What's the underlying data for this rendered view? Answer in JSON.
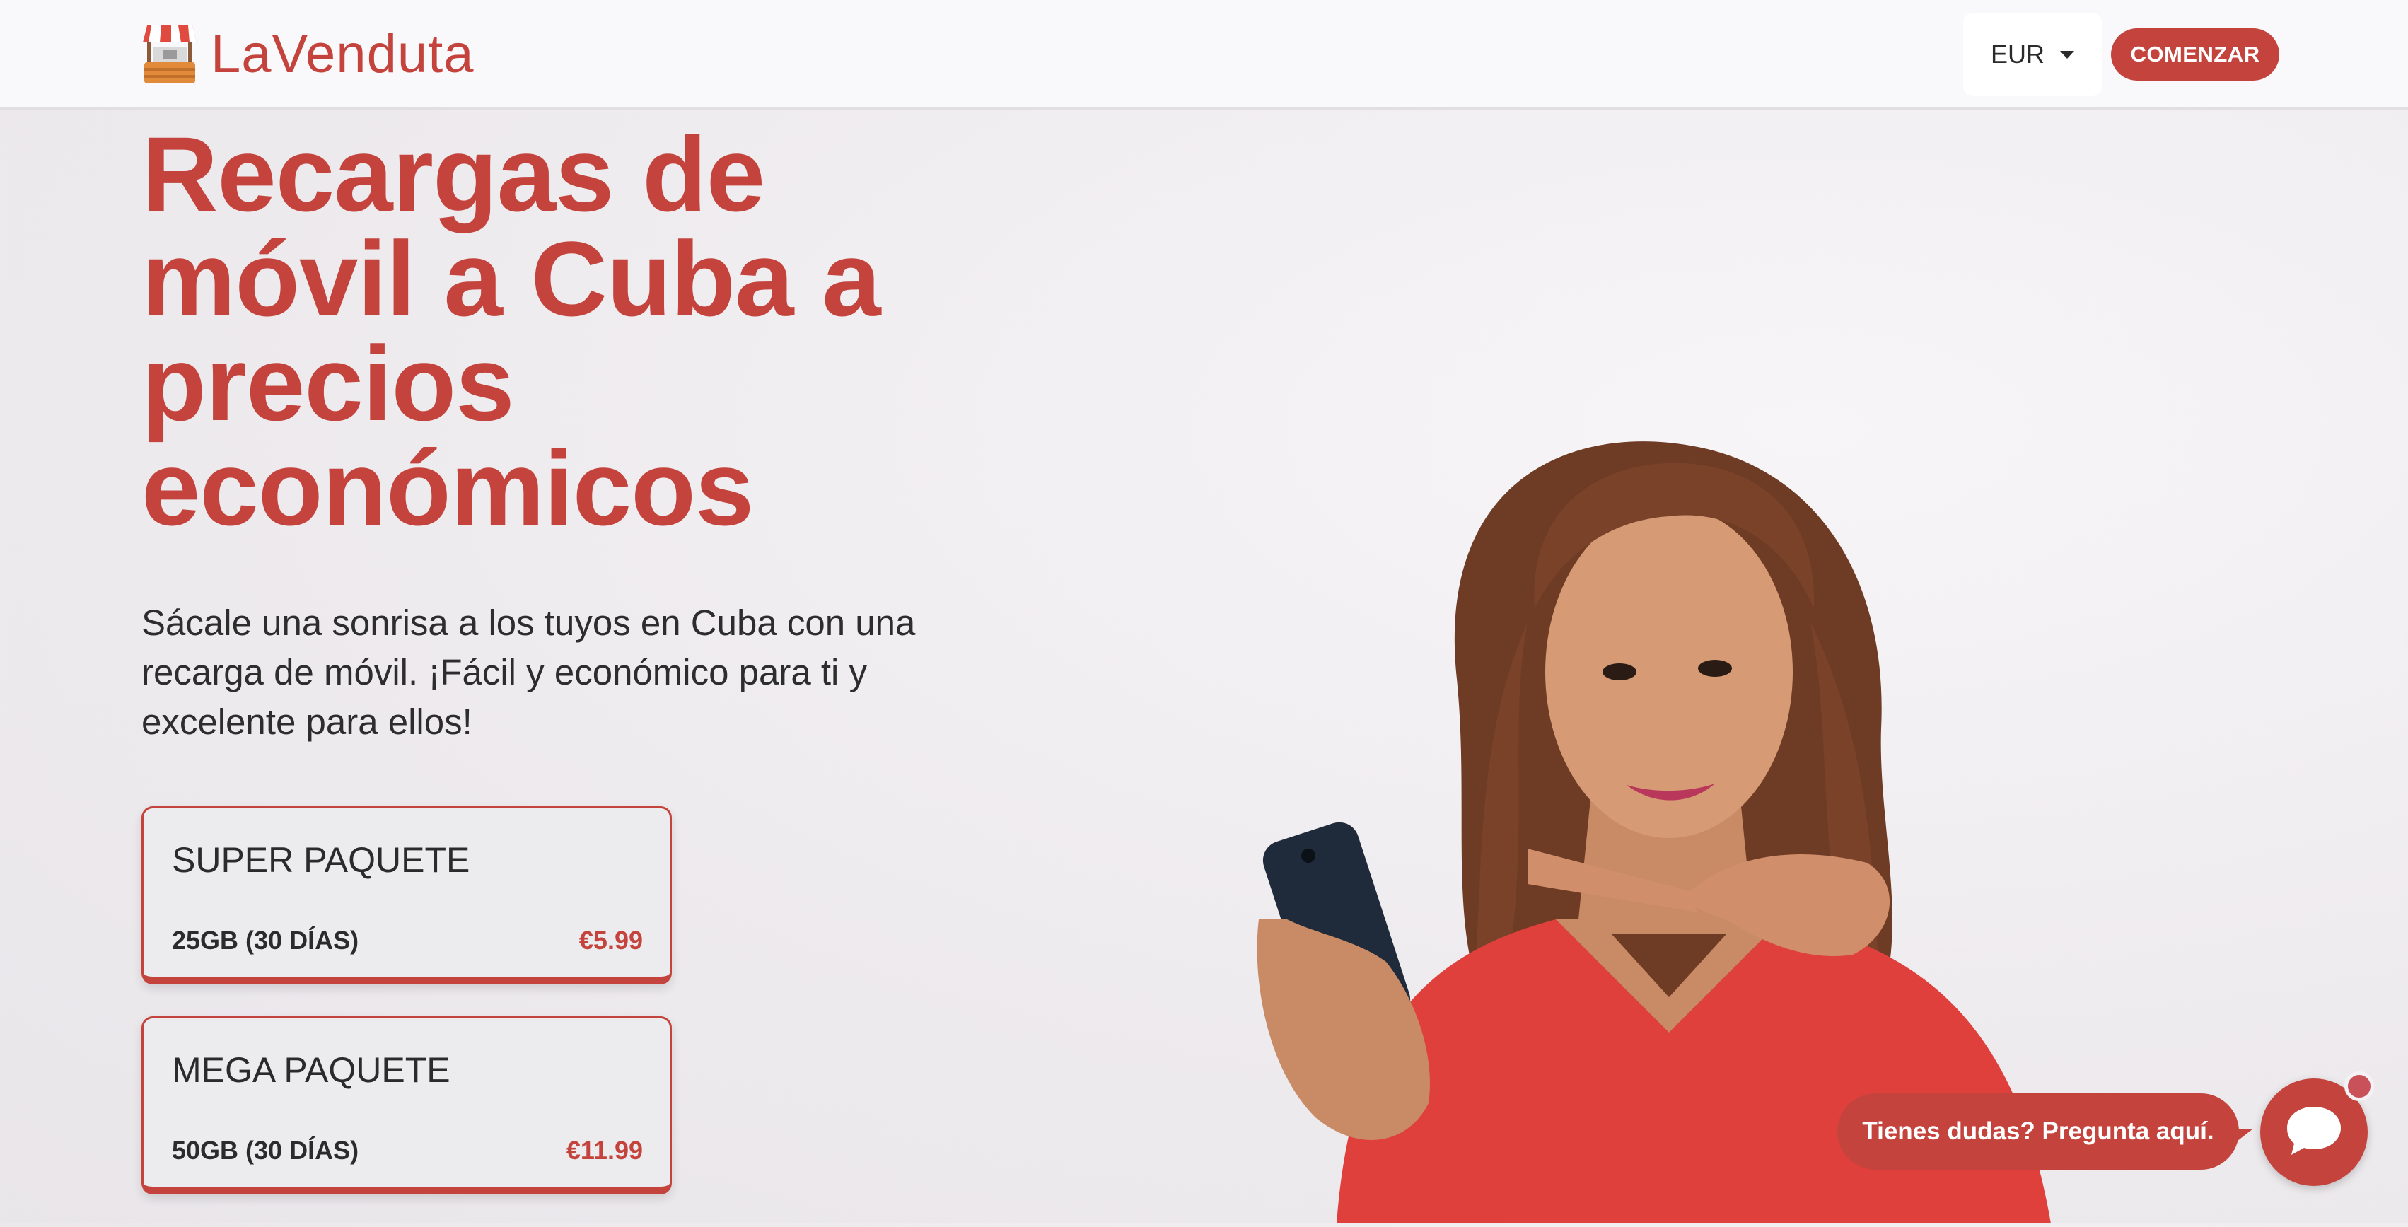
{
  "header": {
    "logo_text": "LaVenduta",
    "currency": "EUR",
    "cta_label": "COMENZAR"
  },
  "hero": {
    "title": "Recargas de móvil a Cuba a precios económicos",
    "subtitle": "Sácale una sonrisa a los tuyos en Cuba con una recarga de móvil. ¡Fácil y económico para ti y excelente para ellos!"
  },
  "packages": [
    {
      "name": "SUPER PAQUETE",
      "data": "25GB (30 DÍAS)",
      "price": "€5.99"
    },
    {
      "name": "MEGA PAQUETE",
      "data": "50GB (30 DÍAS)",
      "price": "€11.99"
    }
  ],
  "chat": {
    "prompt": "Tienes dudas? Pregunta aquí.",
    "icon": "chat-bubble-icon"
  },
  "colors": {
    "brand": "#c4443d",
    "background": "#eeebee",
    "text": "#2b2b2b"
  }
}
